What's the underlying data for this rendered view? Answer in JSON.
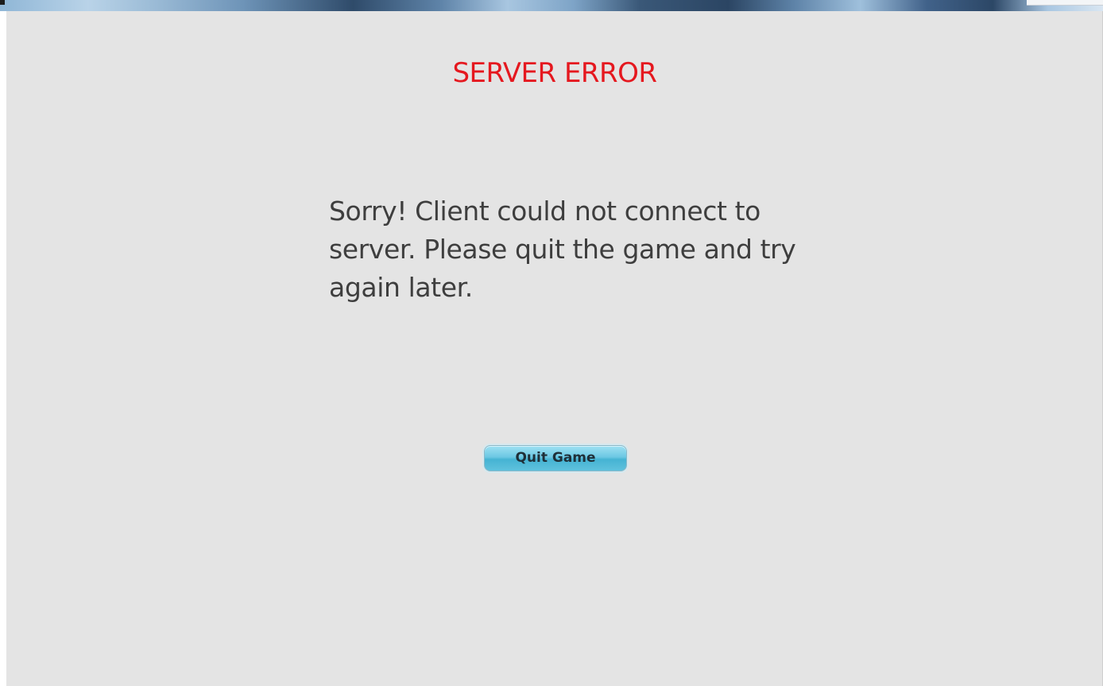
{
  "dialog": {
    "title": "SERVER ERROR",
    "message": "Sorry! Client could not connect to server.  Please quit the game and try again later.",
    "quit_button_label": "Quit Game"
  },
  "colors": {
    "background": "#e4e4e4",
    "title": "#e5181f",
    "message_text": "#3e3e3e",
    "button_fill": "#6cc8e3"
  }
}
